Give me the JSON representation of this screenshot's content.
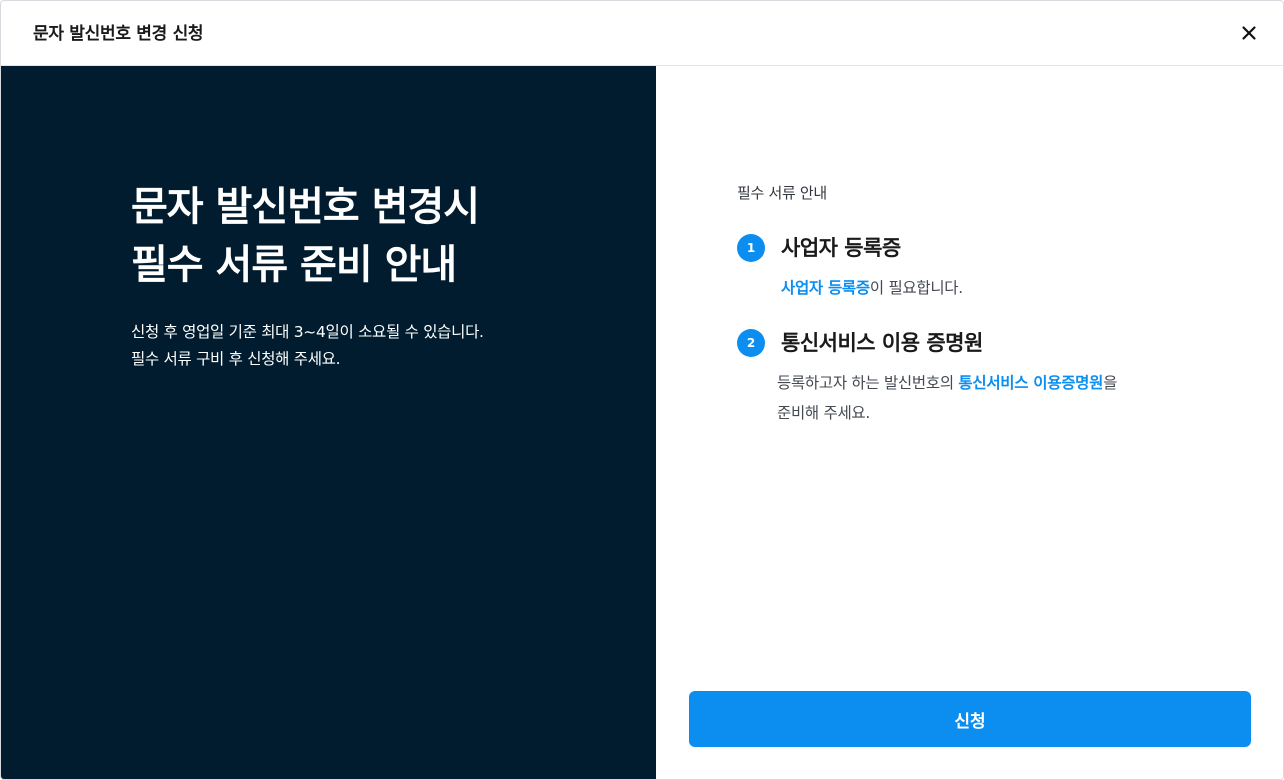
{
  "dialog": {
    "title": "문자 발신번호 변경 신청",
    "close_icon": "close-icon"
  },
  "hero": {
    "title_lines": [
      "문자 발신번호 변경시",
      "필수 서류 준비 안내"
    ],
    "description_lines": [
      "신청 후 영업일 기준 최대 3~4일이 소요될 수 있습니다.",
      "필수 서류 구비 후 신청해 주세요."
    ]
  },
  "guide": {
    "label": "필수 서류 안내",
    "steps": [
      {
        "number": "1",
        "title": "사업자 등록증",
        "body_highlight": "사업자 등록증",
        "body_after": "이 필요합니다."
      },
      {
        "number": "2",
        "title": "통신서비스 이용 증명원",
        "body_before": "등록하고자 하는 발신번호의 ",
        "body_highlight": "통신서비스 이용증명원",
        "body_after": "을",
        "body_line2": "준비해 주세요."
      }
    ]
  },
  "actions": {
    "submit_label": "신청"
  },
  "colors": {
    "accent": "#0c8ef0",
    "hero_background": "#001c2e"
  }
}
